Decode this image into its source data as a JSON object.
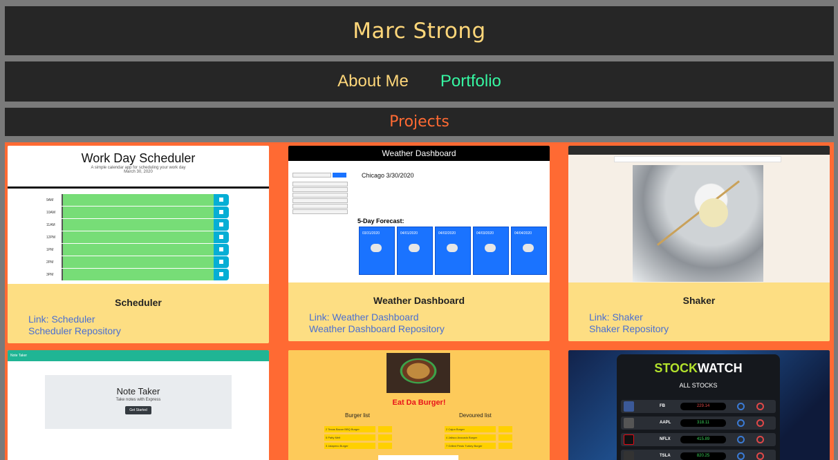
{
  "header": {
    "title": "Marc Strong"
  },
  "nav": {
    "about": "About Me",
    "portfolio": "Portfolio"
  },
  "section": {
    "title": "Projects"
  },
  "cards": [
    {
      "title": "Scheduler",
      "link": "Link: Scheduler",
      "repo": "Scheduler Repository",
      "preview": {
        "heading": "Work Day Scheduler",
        "subtitle": "A simple calendar app for scheduling your work day",
        "date": "March 30, 2020",
        "hours": [
          "9AM",
          "10AM",
          "11AM",
          "12PM",
          "1PM",
          "2PM",
          "3PM"
        ]
      }
    },
    {
      "title": "Weather Dashboard",
      "link": "Link: Weather Dashboard",
      "repo": "Weather Dashboard Repository",
      "preview": {
        "heading": "Weather Dashboard",
        "city": "Chicago 3/30/2020",
        "forecast_label": "5-Day Forecast:",
        "days": [
          "03/31/2020",
          "04/01/2020",
          "04/02/2020",
          "04/03/2020",
          "04/04/2020"
        ]
      }
    },
    {
      "title": "Shaker",
      "link": "Link: Shaker",
      "repo": "Shaker Repository"
    },
    {
      "preview": {
        "heading": "Note Taker",
        "subtitle": "Take notes with Express",
        "button": "Get Started",
        "bar": "Note Taker"
      }
    },
    {
      "preview": {
        "heading": "Eat Da Burger!",
        "list1": "Burger list",
        "list2": "Devoured list",
        "burgers": [
          "2 Texas Bacon BBQ Burger",
          "5 Patty Melt",
          "3 Jalapeno Burger"
        ],
        "devoured": [
          "2 Cajun Burger",
          "4 Jalisco Avocado Burger",
          "7 Grilled Pesto Turkey Burger"
        ]
      }
    },
    {
      "preview": {
        "logo_left": "STOCK",
        "logo_right": "WATCH",
        "subtitle": "ALL STOCKS",
        "stocks": [
          {
            "ticker": "FB",
            "price": "229.14",
            "color": "#e04848"
          },
          {
            "ticker": "AAPL",
            "price": "318.11",
            "color": "#3ad35a"
          },
          {
            "ticker": "NFLX",
            "price": "415.89",
            "color": "#3ad35a"
          },
          {
            "ticker": "TSLA",
            "price": "820.25",
            "color": "#3ad35a"
          }
        ]
      }
    }
  ]
}
